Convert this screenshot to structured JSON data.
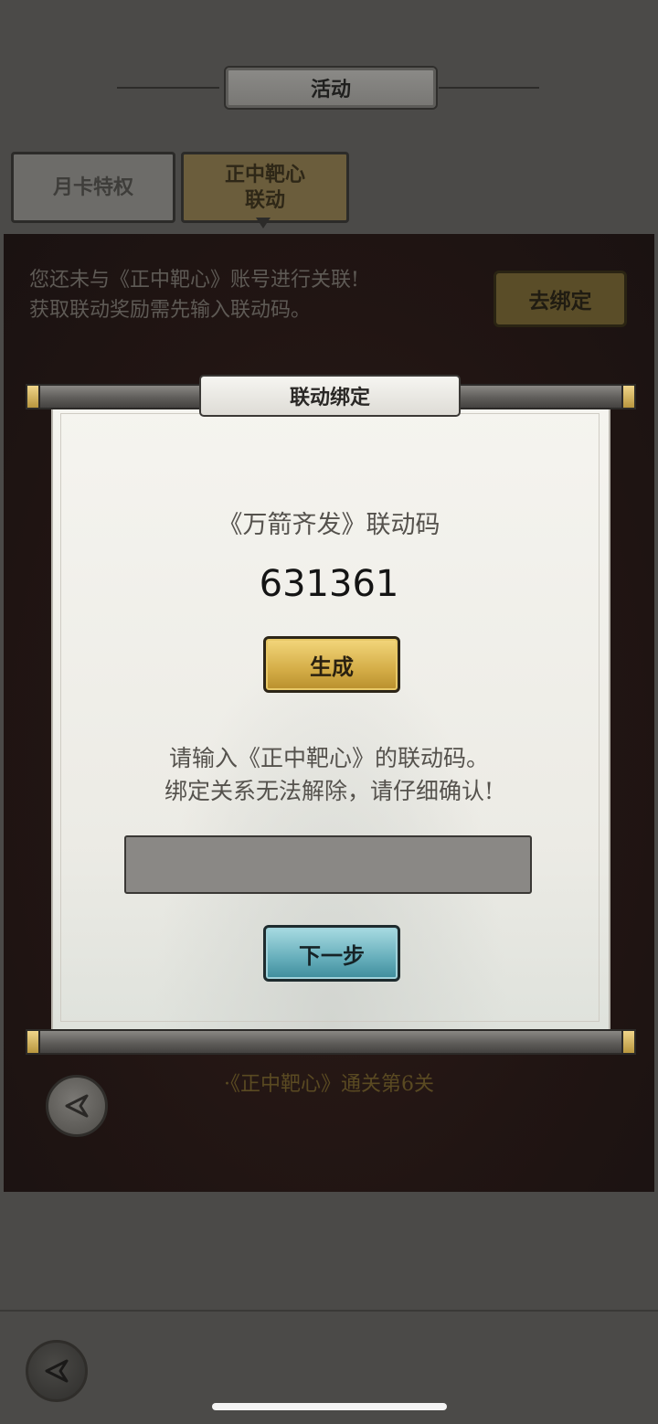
{
  "header": {
    "title": "活动"
  },
  "tabs": [
    {
      "label": "月卡特权",
      "selected": false
    },
    {
      "label": "正中靶心\n联动",
      "selected": true
    }
  ],
  "activity": {
    "notice_line1": "您还未与《正中靶心》账号进行关联!",
    "notice_line2": "获取联动奖励需先输入联动码。",
    "bind_button": "去绑定",
    "requirement": "·《正中靶心》通关第6关"
  },
  "dialog": {
    "title": "联动绑定",
    "code_label": "《万箭齐发》联动码",
    "code_value": "631361",
    "generate_button": "生成",
    "instruction_line1": "请输入《正中靶心》的联动码。",
    "instruction_line2": "绑定关系无法解除，请仔细确认!",
    "input_value": "",
    "next_button": "下一步"
  },
  "colors": {
    "gold_button": "#d4ad47",
    "teal_button": "#66aebb",
    "paper": "#f0efe9"
  },
  "icons": {
    "back": "back-arrow-icon"
  }
}
